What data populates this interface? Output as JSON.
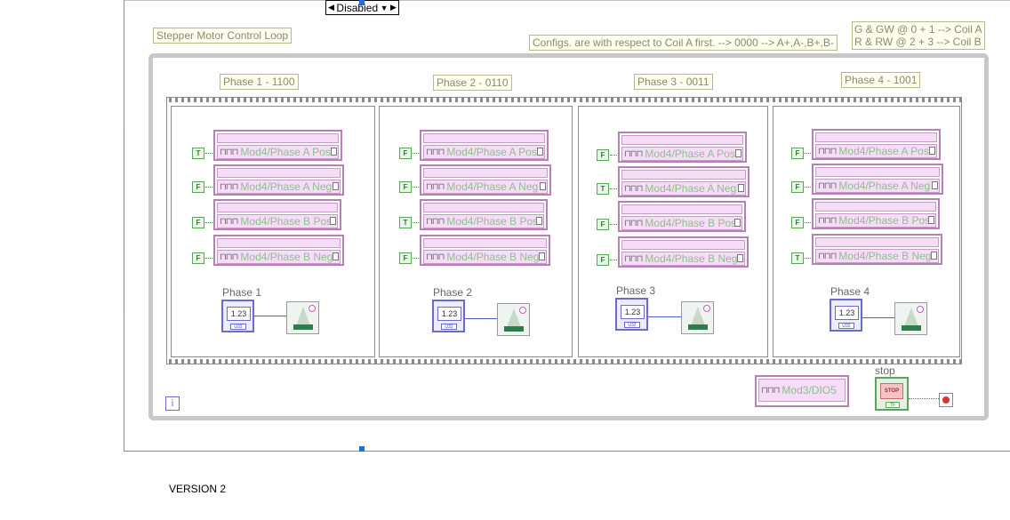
{
  "disable_structure": {
    "selector_label": "Disabied"
  },
  "labels": {
    "loop_title": "Stepper Motor Control Loop",
    "configs_note": "Configs. are with respect to Coil A first. --> 0000 --> A+,A-,B+,B-",
    "coil_note_1": "G & GW @ 0 + 1 --> Coil A",
    "coil_note_2": "R & RW @ 2 + 3 --> Coil B",
    "version": "VERSION 2"
  },
  "frames": [
    {
      "title": "Phase 1 - 1100",
      "channels": [
        {
          "bool": "T",
          "name": "Mod4/Phase A Pos"
        },
        {
          "bool": "F",
          "name": "Mod4/Phase A Neg"
        },
        {
          "bool": "F",
          "name": "Mod4/Phase B Pos"
        },
        {
          "bool": "F",
          "name": "Mod4/Phase B Neg"
        }
      ],
      "const_label": "Phase 1",
      "const_value": "1.23",
      "const_type": "U32"
    },
    {
      "title": "Phase 2 - 0110",
      "channels": [
        {
          "bool": "F",
          "name": "Mod4/Phase A Pos"
        },
        {
          "bool": "F",
          "name": "Mod4/Phase A Neg"
        },
        {
          "bool": "T",
          "name": "Mod4/Phase B Pos"
        },
        {
          "bool": "F",
          "name": "Mod4/Phase B Neg"
        }
      ],
      "const_label": "Phase 2",
      "const_value": "1.23",
      "const_type": "U32"
    },
    {
      "title": "Phase 3 - 0011",
      "channels": [
        {
          "bool": "F",
          "name": "Mod4/Phase A Pos"
        },
        {
          "bool": "T",
          "name": "Mod4/Phase A Neg"
        },
        {
          "bool": "F",
          "name": "Mod4/Phase B Pos"
        },
        {
          "bool": "F",
          "name": "Mod4/Phase B Neg"
        }
      ],
      "const_label": "Phase 3",
      "const_value": "1.23",
      "const_type": "U32"
    },
    {
      "title": "Phase 4 - 1001",
      "channels": [
        {
          "bool": "F",
          "name": "Mod4/Phase A Pos"
        },
        {
          "bool": "F",
          "name": "Mod4/Phase A Neg"
        },
        {
          "bool": "F",
          "name": "Mod4/Phase B Pos"
        },
        {
          "bool": "T",
          "name": "Mod4/Phase B Neg"
        }
      ],
      "const_label": "Phase 4",
      "const_value": "1.23",
      "const_type": "U32"
    }
  ],
  "dio_channel": "Mod3/DIO5",
  "stop": {
    "label": "stop",
    "face": "STOP",
    "type": "TF"
  },
  "loop_iteration": "i",
  "icons": {
    "wave": "pulse-wave-icon",
    "wait": "metronome-wait-icon",
    "condition": "stop-condition-icon"
  }
}
